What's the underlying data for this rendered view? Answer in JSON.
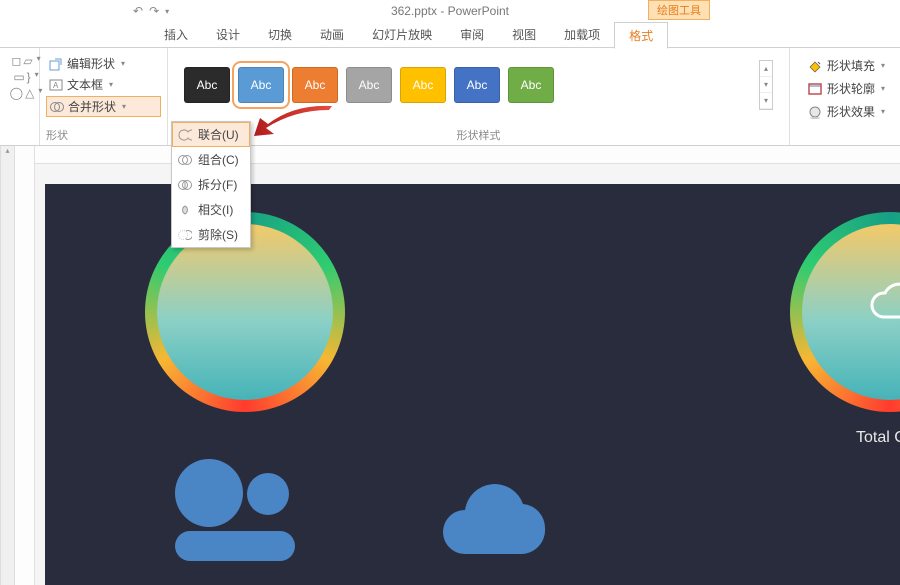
{
  "title": "362.pptx - PowerPoint",
  "drawing_tools_label": "绘图工具",
  "tabs": {
    "insert": "插入",
    "design": "设计",
    "transitions": "切换",
    "animations": "动画",
    "slideshow": "幻灯片放映",
    "review": "审阅",
    "view": "视图",
    "addins": "加载项",
    "format": "格式"
  },
  "shape_group": {
    "edit_shape": "编辑形状",
    "text_box": "文本框",
    "merge_shapes": "合并形状",
    "label": "形状"
  },
  "merge_menu": {
    "union": "联合(U)",
    "combine": "组合(C)",
    "fragment": "拆分(F)",
    "intersect": "相交(I)",
    "subtract": "剪除(S)"
  },
  "styles_group": {
    "label": "形状样式",
    "swatch_text": "Abc",
    "colors": {
      "black": "#2b2b2b",
      "blue": "#5b9bd5",
      "orange": "#ed7d31",
      "gray": "#a5a5a5",
      "yellow": "#ffc000",
      "blue2": "#4472c4",
      "green": "#70ad47"
    }
  },
  "format_cmds": {
    "fill": "形状填充",
    "outline": "形状轮廓",
    "effects": "形状效果"
  },
  "slide": {
    "text": "Total Cor"
  }
}
